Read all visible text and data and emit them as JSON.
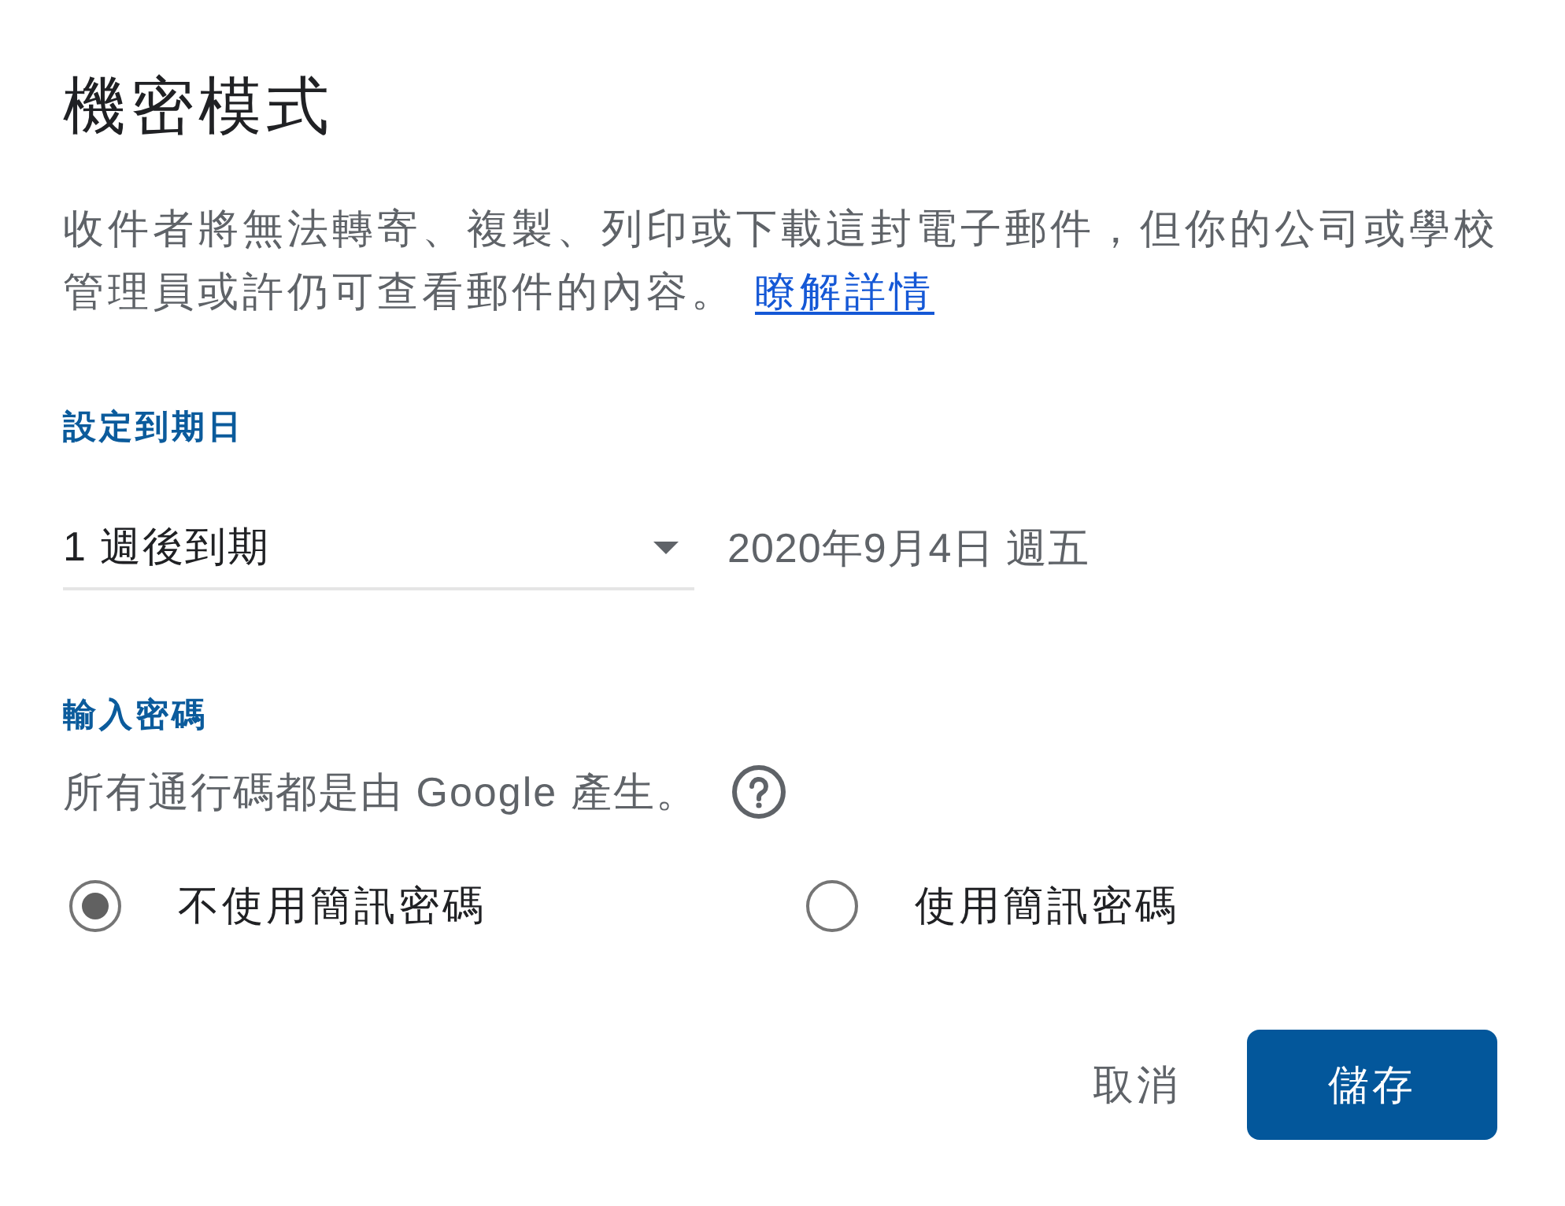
{
  "dialog": {
    "title": "機密模式",
    "description": "收件者將無法轉寄、複製、列印或下載這封電子郵件，但你的公司或學校管理員或許仍可查看郵件的內容。",
    "learn_more_link": "瞭解詳情"
  },
  "expiry": {
    "heading": "設定到期日",
    "select": {
      "value": "1 週後到期"
    },
    "date": "2020年9月4日 週五"
  },
  "passcode": {
    "heading": "輸入密碼",
    "note": "所有通行碼都是由 Google 產生。",
    "options": [
      {
        "label": "不使用簡訊密碼",
        "selected": true
      },
      {
        "label": "使用簡訊密碼",
        "selected": false
      }
    ]
  },
  "buttons": [
    {
      "label": "取消",
      "kind": "text"
    },
    {
      "label": "儲存",
      "kind": "primary"
    }
  ]
}
